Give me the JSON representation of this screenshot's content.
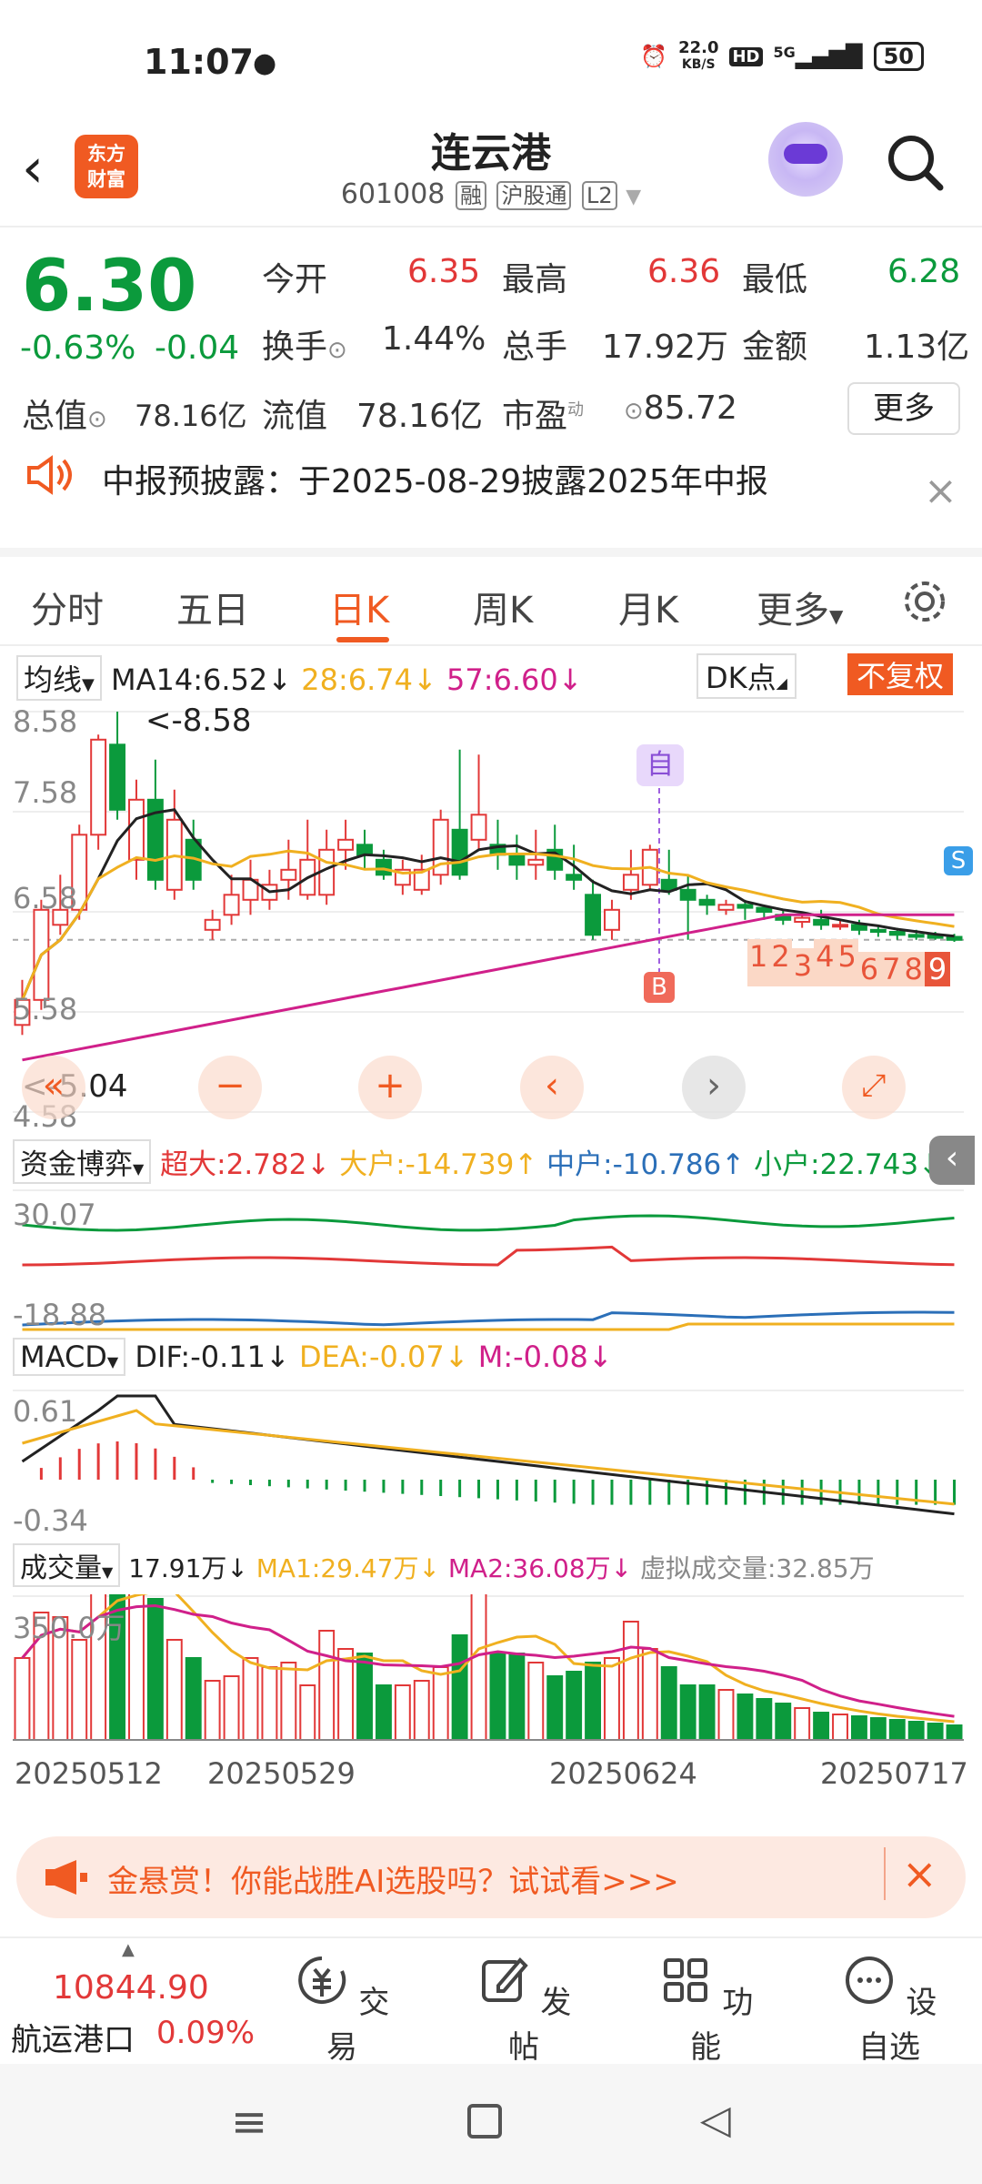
{
  "status": {
    "time": "11:07",
    "network_speed": "22.0",
    "network_unit": "KB/S",
    "hd": "HD",
    "signal": "5G",
    "battery": "50"
  },
  "header": {
    "title": "连云港",
    "code": "601008",
    "tags": [
      "融",
      "沪股通",
      "L2"
    ],
    "logo_line1": "东方",
    "logo_line2": "财富"
  },
  "quote": {
    "price": "6.30",
    "pct": "-0.63%",
    "chg": "-0.04",
    "open_label": "今开",
    "open": "6.35",
    "high_label": "最高",
    "high": "6.36",
    "low_label": "最低",
    "low": "6.28",
    "turnover_label": "换手",
    "turnover": "1.44%",
    "volume_label": "总手",
    "volume": "17.92万",
    "amount_label": "金额",
    "amount": "1.13亿",
    "mcap_label": "总值",
    "mcap": "78.16亿",
    "float_label": "流值",
    "float": "78.16亿",
    "pe_label": "市盈",
    "pe_sup": "动",
    "pe": "85.72",
    "more": "更多"
  },
  "notice": {
    "text": "中报预披露：于2025-08-29披露2025年中报"
  },
  "tabs": [
    "分时",
    "五日",
    "日K",
    "周K",
    "月K",
    "更多"
  ],
  "ma_bar": {
    "selector": "均线",
    "ma14": "MA14:6.52",
    "ma28": "28:6.74",
    "ma57": "57:6.60",
    "dk": "DK点",
    "fuquan": "不复权"
  },
  "kline": {
    "y_labels": [
      "8.58",
      "7.58",
      "6.58",
      "5.58",
      "4.58"
    ],
    "high_marker": "<-8.58",
    "low_marker": "<-5.04",
    "zi": "自",
    "b_marker": "B",
    "s_marker": "S",
    "numbers": [
      "1",
      "2",
      "3",
      "4",
      "5",
      "6",
      "7",
      "8",
      "9"
    ]
  },
  "fund": {
    "selector": "资金博弈",
    "super": "超大:2.782",
    "big": "大户:-14.739",
    "mid": "中户:-10.786",
    "small": "小户:22.743",
    "y_top": "30.07",
    "y_bot": "-18.88"
  },
  "macd": {
    "selector": "MACD",
    "dif": "DIF:-0.11",
    "dea": "DEA:-0.07",
    "m": "M:-0.08",
    "y_top": "0.61",
    "y_bot": "-0.34"
  },
  "volume": {
    "selector": "成交量",
    "vol": "17.91万",
    "ma1": "MA1:29.47万",
    "ma2": "MA2:36.08万",
    "virtual": "虚拟成交量:32.85万",
    "y_top": "350.0万"
  },
  "dates": [
    "20250512",
    "20250529",
    "20250624",
    "20250717"
  ],
  "banner": {
    "text": "金悬赏！你能战胜AI选股吗？试试看>>>"
  },
  "index": {
    "value": "10844.90",
    "name": "航运港口",
    "pct": "0.09%"
  },
  "nav": [
    "交易",
    "发帖",
    "功能",
    "设自选"
  ],
  "colors": {
    "up": "#e23838",
    "down": "#0b9a3c",
    "accent": "#f05a22",
    "ma28": "#f0b020",
    "ma57": "#d0208a",
    "mid": "#2b6fb8"
  },
  "chart_data": {
    "type": "candlestick",
    "candles": [
      [
        5.45,
        5.7,
        5.9,
        5.35
      ],
      [
        5.7,
        6.6,
        6.7,
        5.6
      ],
      [
        6.45,
        6.6,
        6.95,
        6.35
      ],
      [
        6.6,
        7.35,
        7.45,
        6.5
      ],
      [
        7.35,
        8.3,
        8.35,
        7.2
      ],
      [
        8.25,
        7.6,
        8.58,
        7.5
      ],
      [
        7.1,
        7.7,
        7.9,
        6.9
      ],
      [
        7.7,
        6.9,
        8.1,
        6.8
      ],
      [
        6.8,
        7.5,
        7.8,
        6.7
      ],
      [
        7.3,
        6.9,
        7.5,
        6.8
      ],
      [
        6.4,
        6.5,
        6.6,
        6.3
      ],
      [
        6.55,
        6.75,
        6.95,
        6.45
      ],
      [
        6.7,
        6.9,
        7.1,
        6.55
      ],
      [
        6.7,
        6.85,
        7.0,
        6.6
      ],
      [
        6.9,
        7.0,
        7.3,
        6.7
      ],
      [
        6.75,
        7.1,
        7.5,
        6.7
      ],
      [
        6.75,
        7.2,
        7.4,
        6.65
      ],
      [
        7.2,
        7.3,
        7.5,
        7.0
      ],
      [
        7.25,
        7.15,
        7.4,
        7.0
      ],
      [
        7.1,
        6.95,
        7.2,
        6.9
      ],
      [
        6.85,
        7.0,
        7.1,
        6.75
      ],
      [
        6.8,
        7.0,
        7.15,
        6.75
      ],
      [
        6.95,
        7.5,
        7.6,
        6.85
      ],
      [
        7.4,
        6.95,
        8.2,
        6.9
      ],
      [
        7.3,
        7.55,
        8.15,
        7.2
      ],
      [
        7.25,
        7.15,
        7.5,
        7.0
      ],
      [
        7.15,
        7.05,
        7.35,
        6.9
      ],
      [
        7.05,
        7.1,
        7.4,
        6.9
      ],
      [
        7.2,
        7.0,
        7.45,
        6.9
      ],
      [
        6.95,
        6.9,
        7.25,
        6.8
      ],
      [
        6.75,
        6.35,
        6.9,
        6.3
      ],
      [
        6.4,
        6.6,
        6.7,
        6.3
      ],
      [
        6.8,
        6.95,
        7.2,
        6.7
      ],
      [
        6.85,
        7.2,
        7.25,
        6.8
      ],
      [
        6.9,
        6.8,
        7.2,
        6.75
      ],
      [
        6.8,
        6.7,
        6.95,
        6.3
      ],
      [
        6.7,
        6.65,
        6.75,
        6.55
      ],
      [
        6.6,
        6.65,
        6.7,
        6.55
      ],
      [
        6.65,
        6.62,
        6.7,
        6.5
      ],
      [
        6.62,
        6.58,
        6.65,
        6.5
      ],
      [
        6.55,
        6.5,
        6.6,
        6.45
      ],
      [
        6.48,
        6.52,
        6.55,
        6.42
      ],
      [
        6.5,
        6.45,
        6.6,
        6.4
      ],
      [
        6.45,
        6.45,
        6.5,
        6.4
      ],
      [
        6.45,
        6.4,
        6.5,
        6.35
      ],
      [
        6.4,
        6.38,
        6.45,
        6.33
      ],
      [
        6.38,
        6.35,
        6.42,
        6.3
      ],
      [
        6.35,
        6.33,
        6.4,
        6.3
      ],
      [
        6.35,
        6.32,
        6.38,
        6.3
      ],
      [
        6.33,
        6.3,
        6.36,
        6.28
      ]
    ],
    "y_range": [
      4.58,
      8.58
    ],
    "x_ticks": [
      "20250512",
      "20250529",
      "20250624",
      "20250717"
    ]
  }
}
